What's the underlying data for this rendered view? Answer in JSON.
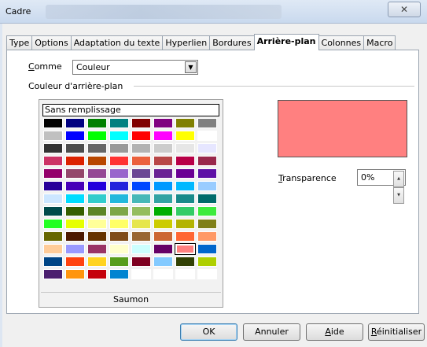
{
  "window": {
    "title": "Cadre",
    "close_glyph": "✕"
  },
  "tabs": [
    {
      "label": "Type",
      "active": false
    },
    {
      "label": "Options",
      "active": false
    },
    {
      "label": "Adaptation du texte",
      "active": false
    },
    {
      "label": "Hyperlien",
      "active": false
    },
    {
      "label": "Bordures",
      "active": false
    },
    {
      "label": "Arrière-plan",
      "active": true
    },
    {
      "label": "Colonnes",
      "active": false
    },
    {
      "label": "Macro",
      "active": false
    }
  ],
  "as": {
    "label_accel": "C",
    "label_rest": "omme",
    "value": "Couleur"
  },
  "section": {
    "title": "Couleur d'arrière-plan"
  },
  "palette": {
    "no_fill_label": "Sans remplissage",
    "selected_name": "Saumon",
    "rows": [
      [
        "#000000",
        "#000080",
        "#008000",
        "#008080",
        "#800000",
        "#800080",
        "#808000",
        "#808080"
      ],
      [
        "#c0c0c0",
        "#0000ff",
        "#00ff00",
        "#00ffff",
        "#ff0000",
        "#ff00ff",
        "#ffff00",
        "#ffffff"
      ],
      [
        "#333333",
        "#4d4d4d",
        "#666666",
        "#999999",
        "#b3b3b3",
        "#cccccc",
        "#e6e6e6",
        "#e6e6ff"
      ],
      [
        "#cc3366",
        "#dc2300",
        "#b84700",
        "#ff3333",
        "#eb613d",
        "#b84747",
        "#b80047",
        "#99284c"
      ],
      [
        "#94006b",
        "#94476b",
        "#944794",
        "#9966cc",
        "#6b4794",
        "#6b2394",
        "#6b0094",
        "#5e11a6"
      ],
      [
        "#280099",
        "#4700b8",
        "#2300dc",
        "#2323dc",
        "#0047ff",
        "#0099ff",
        "#00b8ff",
        "#99ccff"
      ],
      [
        "#cce6ff",
        "#00dcff",
        "#33cccc",
        "#23b8dc",
        "#47b8b8",
        "#33a3a3",
        "#198a8a",
        "#006b6b"
      ],
      [
        "#004a4a",
        "#355e00",
        "#5c8526",
        "#7da647",
        "#94bd5e",
        "#00ae00",
        "#33cc66",
        "#3deb3d"
      ],
      [
        "#23ff23",
        "#e6ff00",
        "#ffff99",
        "#ffff66",
        "#e6e64c",
        "#cccc00",
        "#b3b300",
        "#808019"
      ],
      [
        "#666600",
        "#4c1900",
        "#663300",
        "#804c19",
        "#996633",
        "#cc6633",
        "#ff6633",
        "#ff9966"
      ],
      [
        "#ffcc99",
        "#9999ff",
        "#993366",
        "#ffffcc",
        "#ccffff",
        "#660066",
        "#ff8080",
        "#0066cc"
      ],
      [
        "#004586",
        "#ff420e",
        "#ffd320",
        "#579d1c",
        "#7e0021",
        "#83caff",
        "#314004",
        "#aecf00"
      ],
      [
        "#4b1f6f",
        "#ff950e",
        "#c5000b",
        "#0084d1",
        "#ffffff",
        "#ffffff",
        "#ffffff",
        "#ffffff"
      ]
    ],
    "selected_row": 10,
    "selected_col": 6
  },
  "preview": {
    "color": "#ff8080"
  },
  "transparency": {
    "label_accel": "T",
    "label_rest": "ransparence",
    "value": "0%"
  },
  "buttons": {
    "ok": "OK",
    "cancel": "Annuler",
    "help_accel": "A",
    "help_rest": "ide",
    "reset_accel": "R",
    "reset_rest": "éinitialiser"
  }
}
